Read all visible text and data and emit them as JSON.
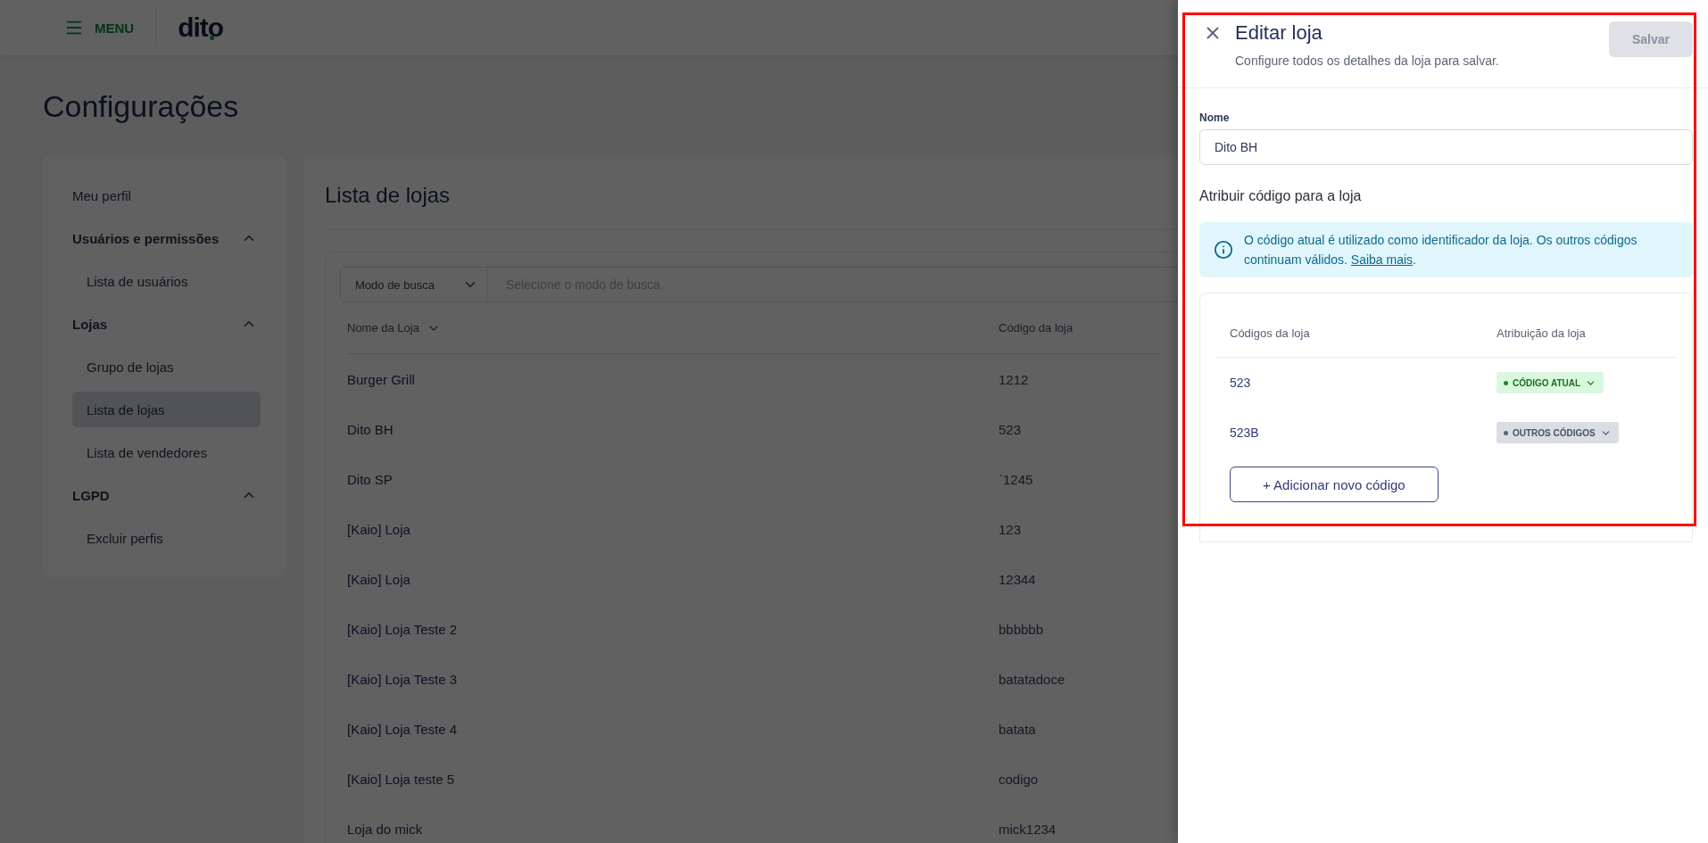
{
  "header": {
    "menu_label": "MENU",
    "logo": "dito"
  },
  "page_title": "Configurações",
  "sidebar": {
    "items": [
      {
        "kind": "link",
        "label": "Meu perfil",
        "selected": false
      },
      {
        "kind": "group",
        "label": "Usuários e permissões",
        "expanded": true,
        "children": [
          {
            "label": "Lista de usuários",
            "selected": false
          }
        ]
      },
      {
        "kind": "group",
        "label": "Lojas",
        "expanded": true,
        "children": [
          {
            "label": "Grupo de lojas",
            "selected": false
          },
          {
            "label": "Lista de lojas",
            "selected": true
          },
          {
            "label": "Lista de vendedores",
            "selected": false
          }
        ]
      },
      {
        "kind": "group",
        "label": "LGPD",
        "expanded": true,
        "children": [
          {
            "label": "Excluir perfis",
            "selected": false
          }
        ]
      }
    ]
  },
  "main": {
    "title": "Lista de lojas",
    "search": {
      "mode_label": "Modo de busca",
      "placeholder": "Selecione o modo de busca"
    },
    "table": {
      "columns": [
        "Nome da Loja",
        "Código da loja"
      ],
      "rows": [
        [
          "Burger Grill",
          "1212"
        ],
        [
          "Dito BH",
          "523"
        ],
        [
          "Dito SP",
          "`1245"
        ],
        [
          "[Kaio] Loja",
          "123"
        ],
        [
          "[Kaio] Loja",
          "12344"
        ],
        [
          "[Kaio] Loja Teste 2",
          "bbbbbb"
        ],
        [
          "[Kaio] Loja Teste 3",
          "batatadoce"
        ],
        [
          "[Kaio] Loja Teste 4",
          "batata"
        ],
        [
          "[Kaio] Loja teste 5",
          "codigo"
        ],
        [
          "Loja do mick",
          "mick1234"
        ]
      ]
    }
  },
  "drawer": {
    "title": "Editar loja",
    "subtitle": "Configure todos os detalhes da loja para salvar.",
    "save_button": {
      "label": "Salvar",
      "disabled": true
    },
    "name_field": {
      "label": "Nome",
      "value": "Dito BH"
    },
    "section_title": "Atribuir código para a loja",
    "info": {
      "text": "O código atual é utilizado como identificador da loja. Os outros códigos continuam válidos.",
      "link": "Saiba mais",
      "suffix": "."
    },
    "codes": {
      "columns": [
        "Códigos da loja",
        "Atribuição da loja"
      ],
      "rows": [
        {
          "code": "523",
          "status": "CÓDIGO ATUAL",
          "kind": "current"
        },
        {
          "code": "523B",
          "status": "OUTROS CÓDIGOS",
          "kind": "other"
        }
      ]
    },
    "add_button": "+ Adicionar novo código"
  }
}
